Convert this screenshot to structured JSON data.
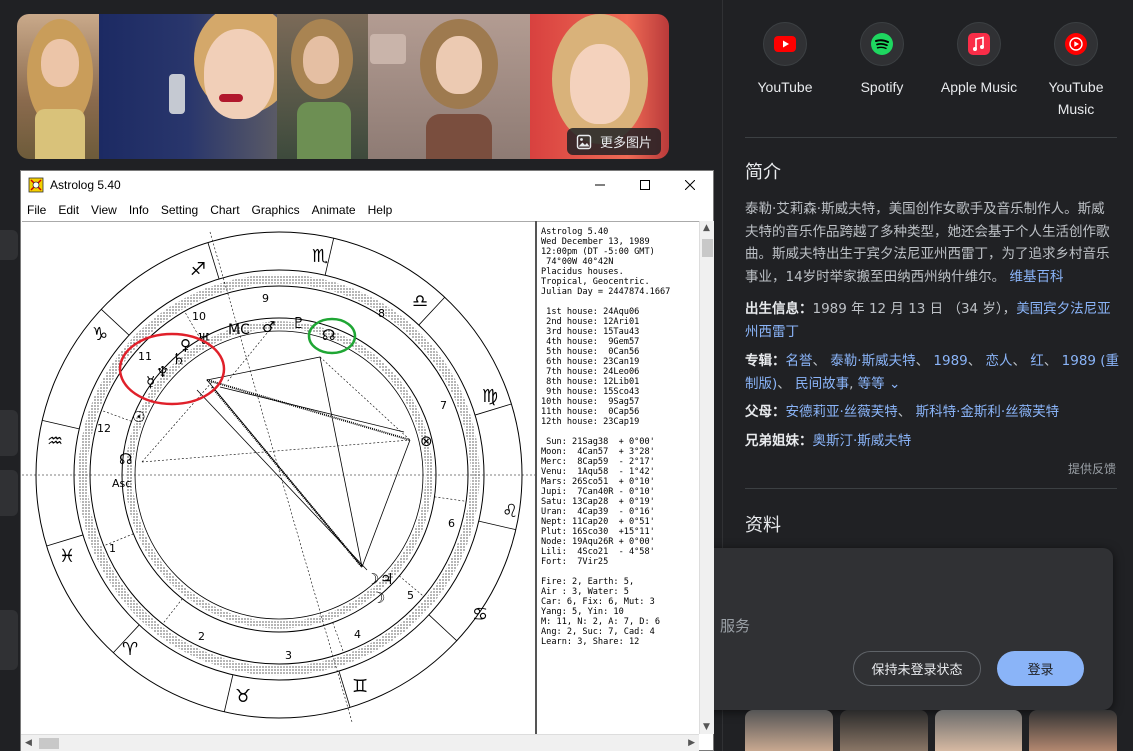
{
  "gallery": {
    "more_images_label": "更多图片"
  },
  "streaming": [
    {
      "label_line1": "YouTube",
      "label_line2": "",
      "icon": "youtube-icon",
      "color": "#ff0000"
    },
    {
      "label_line1": "Spotify",
      "label_line2": "",
      "icon": "spotify-icon",
      "color": "#1ed760"
    },
    {
      "label_line1": "Apple Music",
      "label_line2": "",
      "icon": "apple-music-icon",
      "color": "#fa2d48"
    },
    {
      "label_line1": "YouTube",
      "label_line2": "Music",
      "icon": "youtube-music-icon",
      "color": "#ff0000"
    }
  ],
  "intro": {
    "title": "简介",
    "text": "泰勒·艾莉森·斯威夫特，美国创作女歌手及音乐制作人。斯威夫特的音乐作品跨越了多种类型，她还会基于个人生活创作歌曲。斯威夫特出生于宾夕法尼亚州西雷丁，为了追求乡村音乐事业，14岁时举家搬至田纳西州纳什维尔。",
    "source_link": "维基百科"
  },
  "facts": {
    "birth_label": "出生信息：",
    "birth_text": "1989 年 12 月 13 日 （34 岁），",
    "birth_link": "美国宾夕法尼亚州西雷丁",
    "albums_label": "专辑：",
    "albums": [
      "名誉",
      "泰勒·斯威夫特",
      "1989",
      "恋人",
      "红",
      "1989 (重制版)",
      "民间故事"
    ],
    "albums_more": "等等",
    "parents_label": "父母：",
    "parents": [
      "安德莉亚·丝薇芙特",
      "斯科特·金斯利·丝薇芙特"
    ],
    "siblings_label": "兄弟姐妹：",
    "siblings": [
      "奥斯汀·斯威夫特"
    ],
    "feedback": "提供反馈"
  },
  "data_section": {
    "title": "资料"
  },
  "popup": {
    "service_text": "服务",
    "keep_button": "保持未登录状态",
    "login_button": "登录"
  },
  "window": {
    "title": "Astrolog 5.40",
    "menu": [
      "File",
      "Edit",
      "View",
      "Info",
      "Setting",
      "Chart",
      "Graphics",
      "Animate",
      "Help"
    ],
    "chart_text": [
      "Astrolog 5.40",
      "Wed December 13, 1989",
      "12:00pm (DT -5:00 GMT)",
      " 74°00W 40°42N",
      "Placidus houses.",
      "Tropical, Geocentric.",
      "Julian Day = 2447874.1667",
      "",
      " 1st house: 24Aqu06",
      " 2nd house: 12Ari01",
      " 3rd house: 15Tau43",
      " 4th house:  9Gem57",
      " 5th house:  0Can56",
      " 6th house: 23Can19",
      " 7th house: 24Leo06",
      " 8th house: 12Lib01",
      " 9th house: 15Sco43",
      "10th house:  9Sag57",
      "11th house:  0Cap56",
      "12th house: 23Cap19",
      "",
      " Sun: 21Sag38  + 0°00'",
      "Moon:  4Can57  + 3°28'",
      "Merc:  8Cap59  - 2°17'",
      "Venu:  1Aqu58  - 1°42'",
      "Mars: 26Sco51  + 0°10'",
      "Jupi:  7Can40R - 0°10'",
      "Satu: 13Cap28  + 0°19'",
      "Uran:  4Cap39  - 0°16'",
      "Nept: 11Cap20  + 0°51'",
      "Plut: 16Sco30  +15°11'",
      "Node: 19Aqu26R + 0°00'",
      "Lili:  4Sco21  - 4°58'",
      "Fort:  7Vir25",
      "",
      "Fire: 2, Earth: 5,",
      "Air : 3, Water: 5",
      "Car: 6, Fix: 6, Mut: 3",
      "Yang: 5, Yin: 10",
      "M: 11, N: 2, A: 7, D: 6",
      "Ang: 2, Suc: 7, Cad: 4",
      "Learn: 3, Share: 12"
    ],
    "house_numbers": [
      "1",
      "2",
      "3",
      "4",
      "5",
      "6",
      "7",
      "8",
      "9",
      "10",
      "11",
      "12"
    ],
    "asc_label": "Asc"
  }
}
